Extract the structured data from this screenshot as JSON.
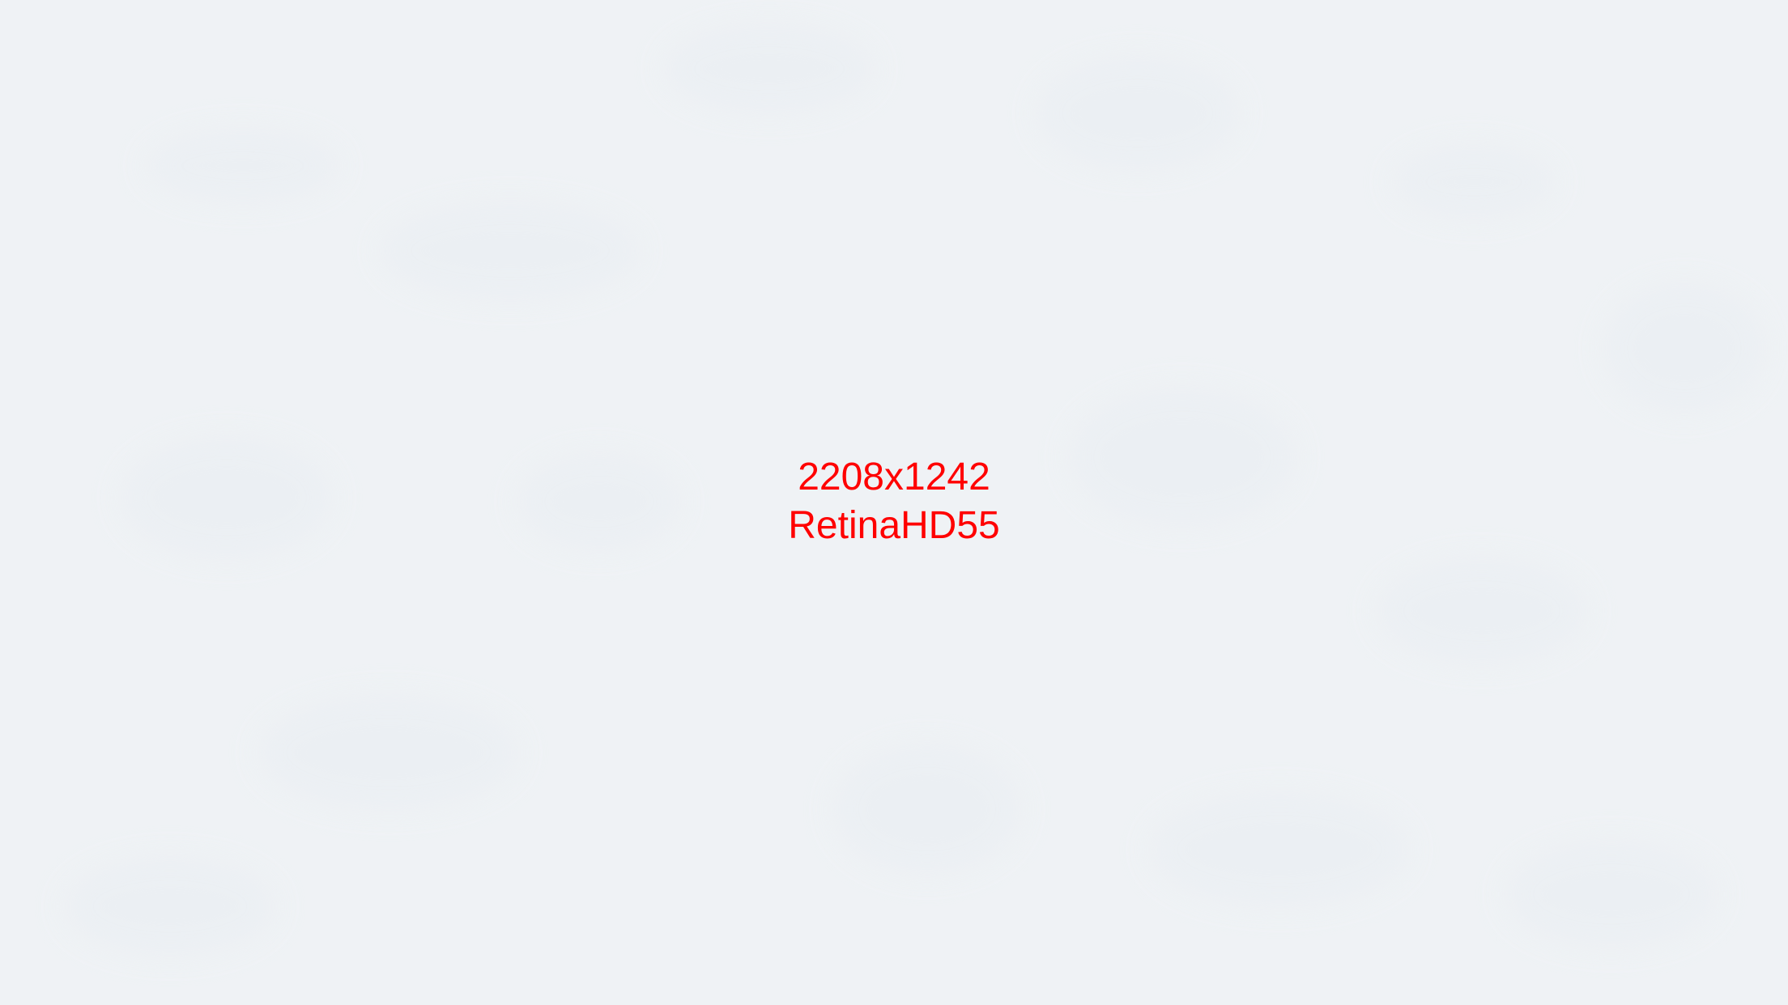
{
  "placeholder": {
    "dimensions_text": "2208x1242",
    "device_text": "RetinaHD55",
    "text_color": "#ff0000",
    "background_color": "#eff2f5"
  }
}
